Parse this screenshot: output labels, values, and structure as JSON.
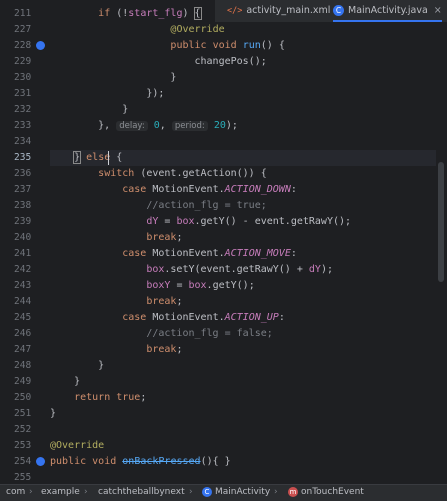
{
  "tabs": [
    {
      "icon": "xml-file-icon",
      "icon_text": "</>",
      "label": "activity_main.xml",
      "active": false
    },
    {
      "icon": "java-class-icon",
      "icon_text": "C",
      "label": "MainActivity.java",
      "active": true,
      "close": "×"
    }
  ],
  "current_line": "235",
  "lines": [
    {
      "num": "211",
      "tokens": [
        {
          "t": "        "
        },
        {
          "t": "if",
          "c": "kw"
        },
        {
          "t": " (!"
        },
        {
          "t": "start_flg",
          "c": "field"
        },
        {
          "t": ") "
        },
        {
          "t": "{",
          "c": "brace"
        }
      ]
    },
    {
      "num": "227",
      "tokens": [
        {
          "t": "                    "
        },
        {
          "t": "@Override",
          "c": "ann"
        }
      ]
    },
    {
      "num": "228",
      "marker": "override",
      "tokens": [
        {
          "t": "                    "
        },
        {
          "t": "public",
          "c": "kw"
        },
        {
          "t": " "
        },
        {
          "t": "void",
          "c": "kw"
        },
        {
          "t": " "
        },
        {
          "t": "run",
          "c": "fn"
        },
        {
          "t": "() {"
        }
      ]
    },
    {
      "num": "229",
      "tokens": [
        {
          "t": "                        changePos();"
        }
      ]
    },
    {
      "num": "230",
      "tokens": [
        {
          "t": "                    }"
        }
      ]
    },
    {
      "num": "231",
      "tokens": [
        {
          "t": "                });"
        }
      ]
    },
    {
      "num": "232",
      "tokens": [
        {
          "t": "            }"
        }
      ]
    },
    {
      "num": "233",
      "tokens": [
        {
          "t": "        }, "
        },
        {
          "t": "delay:",
          "c": "hint"
        },
        {
          "t": " "
        },
        {
          "t": "0",
          "c": "num"
        },
        {
          "t": ", "
        },
        {
          "t": "period:",
          "c": "hint"
        },
        {
          "t": " "
        },
        {
          "t": "20",
          "c": "num"
        },
        {
          "t": ");"
        }
      ]
    },
    {
      "num": "234",
      "tokens": []
    },
    {
      "num": "235",
      "current": true,
      "caret": true,
      "tokens": [
        {
          "t": "    "
        },
        {
          "t": "}",
          "c": "brace"
        },
        {
          "t": " "
        },
        {
          "t": "else",
          "c": "kw"
        },
        {
          "t": " {"
        }
      ]
    },
    {
      "num": "236",
      "tokens": [
        {
          "t": "        "
        },
        {
          "t": "switch",
          "c": "kw"
        },
        {
          "t": " (event.getAction()) {"
        }
      ]
    },
    {
      "num": "237",
      "tokens": [
        {
          "t": "            "
        },
        {
          "t": "case",
          "c": "kw"
        },
        {
          "t": " MotionEvent."
        },
        {
          "t": "ACTION_DOWN",
          "c": "const"
        },
        {
          "t": ":"
        }
      ]
    },
    {
      "num": "238",
      "tokens": [
        {
          "t": "                "
        },
        {
          "t": "//action_flg = true;",
          "c": "comment"
        }
      ]
    },
    {
      "num": "239",
      "tokens": [
        {
          "t": "                "
        },
        {
          "t": "dY",
          "c": "field"
        },
        {
          "t": " = "
        },
        {
          "t": "box",
          "c": "field"
        },
        {
          "t": ".getY() - event.getRawY();"
        }
      ]
    },
    {
      "num": "240",
      "tokens": [
        {
          "t": "                "
        },
        {
          "t": "break",
          "c": "kw"
        },
        {
          "t": ";"
        }
      ]
    },
    {
      "num": "241",
      "tokens": [
        {
          "t": "            "
        },
        {
          "t": "case",
          "c": "kw"
        },
        {
          "t": " MotionEvent."
        },
        {
          "t": "ACTION_MOVE",
          "c": "const"
        },
        {
          "t": ":"
        }
      ]
    },
    {
      "num": "242",
      "tokens": [
        {
          "t": "                "
        },
        {
          "t": "box",
          "c": "field"
        },
        {
          "t": ".setY(event.getRawY() + "
        },
        {
          "t": "dY",
          "c": "field"
        },
        {
          "t": ");"
        }
      ]
    },
    {
      "num": "243",
      "tokens": [
        {
          "t": "                "
        },
        {
          "t": "boxY",
          "c": "field"
        },
        {
          "t": " = "
        },
        {
          "t": "box",
          "c": "field"
        },
        {
          "t": ".getY();"
        }
      ]
    },
    {
      "num": "244",
      "tokens": [
        {
          "t": "                "
        },
        {
          "t": "break",
          "c": "kw"
        },
        {
          "t": ";"
        }
      ]
    },
    {
      "num": "245",
      "tokens": [
        {
          "t": "            "
        },
        {
          "t": "case",
          "c": "kw"
        },
        {
          "t": " MotionEvent."
        },
        {
          "t": "ACTION_UP",
          "c": "const"
        },
        {
          "t": ":"
        }
      ]
    },
    {
      "num": "246",
      "tokens": [
        {
          "t": "                "
        },
        {
          "t": "//action_flg = false;",
          "c": "comment"
        }
      ]
    },
    {
      "num": "247",
      "tokens": [
        {
          "t": "                "
        },
        {
          "t": "break",
          "c": "kw"
        },
        {
          "t": ";"
        }
      ]
    },
    {
      "num": "248",
      "tokens": [
        {
          "t": "        }"
        }
      ]
    },
    {
      "num": "249",
      "tokens": [
        {
          "t": "    }"
        }
      ]
    },
    {
      "num": "250",
      "tokens": [
        {
          "t": "    "
        },
        {
          "t": "return",
          "c": "kw"
        },
        {
          "t": " "
        },
        {
          "t": "true",
          "c": "kw"
        },
        {
          "t": ";"
        }
      ]
    },
    {
      "num": "251",
      "tokens": [
        {
          "t": "}"
        }
      ]
    },
    {
      "num": "252",
      "tokens": []
    },
    {
      "num": "253",
      "tokens": [
        {
          "t": "@Override",
          "c": "ann"
        }
      ]
    },
    {
      "num": "254",
      "marker": "override",
      "tokens": [
        {
          "t": "public",
          "c": "kw"
        },
        {
          "t": " "
        },
        {
          "t": "void",
          "c": "kw"
        },
        {
          "t": " "
        },
        {
          "t": "onBackPressed",
          "c": "depr"
        },
        {
          "t": "(){ }"
        }
      ]
    },
    {
      "num": "255",
      "tokens": []
    },
    {
      "num": "256",
      "tokens": []
    },
    {
      "num": "257",
      "tokens": [
        {
          "t": "}"
        }
      ]
    }
  ],
  "breadcrumb": [
    {
      "label": "com",
      "icon": null
    },
    {
      "label": "example",
      "icon": null
    },
    {
      "label": "catchtheballbynext",
      "icon": null
    },
    {
      "label": "MainActivity",
      "icon": "class-icon",
      "icon_text": "C"
    },
    {
      "label": "onTouchEvent",
      "icon": "method-icon",
      "icon_text": "m"
    }
  ],
  "breadcrumb_separator": "›",
  "colors": {
    "background": "#1e1f22",
    "keyword": "#cf8e6d",
    "function": "#56a8f5",
    "field": "#c77dbb",
    "number": "#2aacb8",
    "comment": "#7a7e85",
    "annotation": "#b3ae60",
    "accent": "#3574f0"
  }
}
